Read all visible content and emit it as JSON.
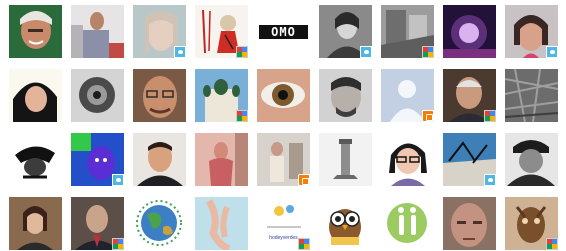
{
  "gallery": {
    "tiles": [
      {
        "id": "avatar-1",
        "badge": ""
      },
      {
        "id": "avatar-2",
        "badge": ""
      },
      {
        "id": "avatar-3",
        "badge": "twitter"
      },
      {
        "id": "avatar-4",
        "badge": "google"
      },
      {
        "id": "avatar-5",
        "badge": "",
        "wordmark": "OMO"
      },
      {
        "id": "avatar-6",
        "badge": "twitter"
      },
      {
        "id": "avatar-7",
        "badge": "google"
      },
      {
        "id": "avatar-8",
        "badge": ""
      },
      {
        "id": "avatar-9",
        "badge": "twitter"
      },
      {
        "id": "avatar-10",
        "badge": ""
      },
      {
        "id": "avatar-11",
        "badge": ""
      },
      {
        "id": "avatar-12",
        "badge": ""
      },
      {
        "id": "avatar-13",
        "badge": ""
      },
      {
        "id": "avatar-14",
        "badge": ""
      },
      {
        "id": "avatar-15",
        "badge": ""
      },
      {
        "id": "avatar-16",
        "badge": "blogger"
      },
      {
        "id": "avatar-17",
        "badge": "google"
      },
      {
        "id": "avatar-18",
        "badge": ""
      },
      {
        "id": "avatar-19",
        "badge": ""
      },
      {
        "id": "avatar-20",
        "badge": "twitter"
      },
      {
        "id": "avatar-21",
        "badge": ""
      },
      {
        "id": "avatar-22",
        "badge": ""
      },
      {
        "id": "avatar-23",
        "badge": "blogger"
      },
      {
        "id": "avatar-24",
        "badge": ""
      },
      {
        "id": "avatar-25",
        "badge": ""
      },
      {
        "id": "avatar-26",
        "badge": "twitter"
      },
      {
        "id": "avatar-27",
        "badge": ""
      },
      {
        "id": "avatar-28",
        "badge": ""
      },
      {
        "id": "avatar-29",
        "badge": "google"
      },
      {
        "id": "avatar-30",
        "badge": ""
      },
      {
        "id": "avatar-31",
        "badge": ""
      },
      {
        "id": "avatar-32",
        "badge": ""
      },
      {
        "id": "avatar-33",
        "badge": ""
      },
      {
        "id": "avatar-34",
        "badge": "google",
        "caption": "hodeyverdes"
      },
      {
        "id": "avatar-35",
        "badge": ""
      },
      {
        "id": "avatar-36",
        "badge": ""
      },
      {
        "id": "avatar-37",
        "badge": ""
      },
      {
        "id": "avatar-38",
        "badge": "google"
      }
    ]
  },
  "colors": {
    "twitter_badge": "#4db7e8",
    "blogger_badge": "#f57d00"
  }
}
